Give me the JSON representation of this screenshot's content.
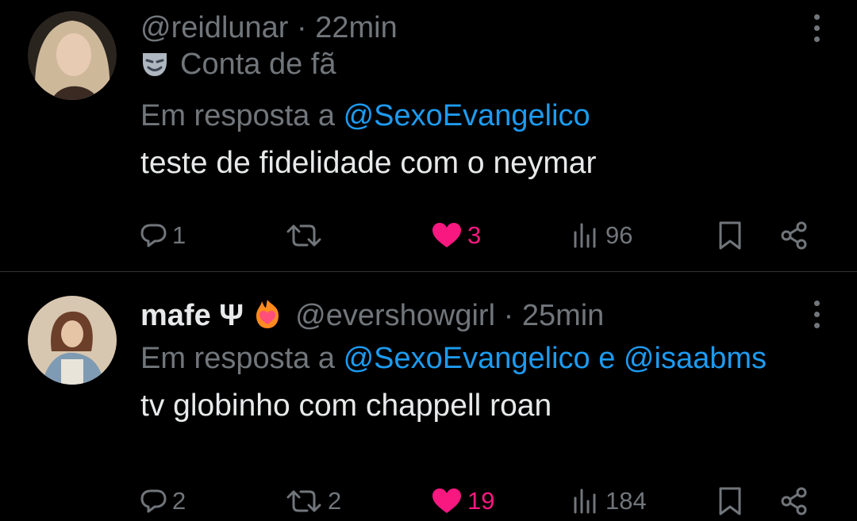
{
  "tweets": [
    {
      "display_name": "",
      "handle": "@reidlunar",
      "dot": "·",
      "time": "22min",
      "label": "Conta de fã",
      "reply_prefix": "Em resposta a",
      "reply_to": "@SexoEvangelico",
      "reply_conj": "",
      "reply_to_2": "",
      "text": "teste de fidelidade com o neymar",
      "replies": "1",
      "retweets": "",
      "likes": "3",
      "views": "96"
    },
    {
      "display_name": "mafe Ψ",
      "handle": "@evershowgirl",
      "dot": "·",
      "time": "25min",
      "label": "",
      "reply_prefix": "Em resposta a",
      "reply_to": "@SexoEvangelico",
      "reply_conj": "e",
      "reply_to_2": "@isaabms",
      "text": "tv globinho com chappell roan",
      "replies": "2",
      "retweets": "2",
      "likes": "19",
      "views": "184"
    }
  ],
  "colors": {
    "accent": "#1d9bf0",
    "like": "#f91880",
    "muted": "#71767b"
  }
}
